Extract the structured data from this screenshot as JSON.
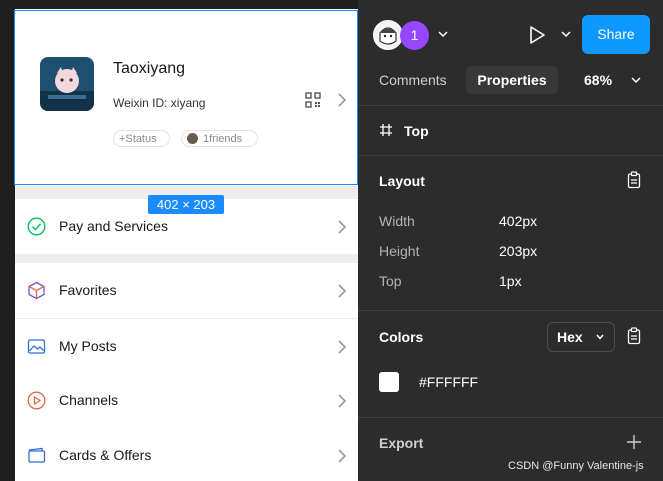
{
  "canvas": {
    "profile": {
      "nickname": "Taoxiyang",
      "weixin_id": "Weixin ID: xiyang",
      "status_pill": "+Status",
      "friends_pill": "1friends"
    },
    "dimension_badge": "402 × 203",
    "menu": [
      {
        "label": "Pay and Services",
        "icon": "pay-services-icon"
      },
      {
        "label": "Favorites",
        "icon": "favorites-icon"
      },
      {
        "label": "My Posts",
        "icon": "my-posts-icon"
      },
      {
        "label": "Channels",
        "icon": "channels-icon"
      },
      {
        "label": "Cards & Offers",
        "icon": "cards-offers-icon"
      }
    ]
  },
  "toolbar": {
    "collaborator_count": "1",
    "share_label": "Share",
    "tabs": {
      "comments": "Comments",
      "properties": "Properties"
    },
    "zoom": "68%"
  },
  "frame": {
    "name": "Top"
  },
  "layout": {
    "title": "Layout",
    "width_label": "Width",
    "width_value": "402px",
    "height_label": "Height",
    "height_value": "203px",
    "top_label": "Top",
    "top_value": "1px"
  },
  "colors": {
    "title": "Colors",
    "format": "Hex",
    "swatch_hex": "#FFFFFF",
    "swatch_label": "#FFFFFF"
  },
  "export": {
    "title": "Export"
  },
  "watermark": "CSDN @Funny Valentine-js",
  "theme": {
    "accent": "#0d99ff",
    "selection": "#1a8cff",
    "panel_bg": "#2c2c2c",
    "collaborator": "#9747ff"
  }
}
